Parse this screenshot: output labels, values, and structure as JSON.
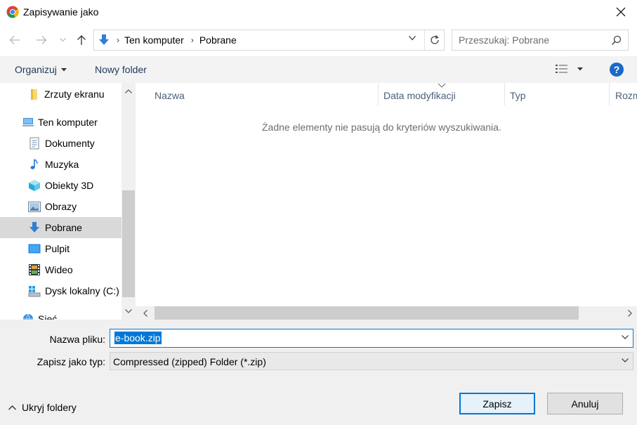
{
  "window": {
    "title": "Zapisywanie jako"
  },
  "address": {
    "crumbs": [
      "Ten komputer",
      "Pobrane"
    ]
  },
  "search": {
    "placeholder": "Przeszukaj: Pobrane"
  },
  "toolbar": {
    "organize_label": "Organizuj",
    "new_folder_label": "Nowy folder",
    "help_label": "?"
  },
  "sidebar": {
    "items": [
      {
        "label": "Zrzuty ekranu",
        "icon": "folder-icon"
      },
      {
        "label": "Ten komputer",
        "icon": "computer-icon"
      },
      {
        "label": "Dokumenty",
        "icon": "documents-icon"
      },
      {
        "label": "Muzyka",
        "icon": "music-icon"
      },
      {
        "label": "Obiekty 3D",
        "icon": "objects-3d-icon"
      },
      {
        "label": "Obrazy",
        "icon": "pictures-icon"
      },
      {
        "label": "Pobrane",
        "icon": "downloads-icon",
        "selected": true
      },
      {
        "label": "Pulpit",
        "icon": "desktop-icon"
      },
      {
        "label": "Wideo",
        "icon": "video-icon"
      },
      {
        "label": "Dysk lokalny (C:)",
        "icon": "drive-icon"
      },
      {
        "label": "Sieć",
        "icon": "network-icon"
      }
    ]
  },
  "file_list": {
    "columns": [
      "Nazwa",
      "Data modyfikacji",
      "Typ",
      "Rozm"
    ],
    "empty_message": "Żadne elementy nie pasują do kryteriów wyszukiwania."
  },
  "form": {
    "filename_label": "Nazwa pliku:",
    "filename_value": "e-book.zip",
    "filetype_label": "Zapisz jako typ:",
    "filetype_value": "Compressed (zipped) Folder (*.zip)"
  },
  "footer": {
    "hide_folders_label": "Ukryj foldery",
    "save_label": "Zapisz",
    "cancel_label": "Anuluj"
  },
  "colors": {
    "accent": "#0078d7",
    "selected_row": "#d9d9d9",
    "bottom_panel": "#f0f0f0"
  }
}
